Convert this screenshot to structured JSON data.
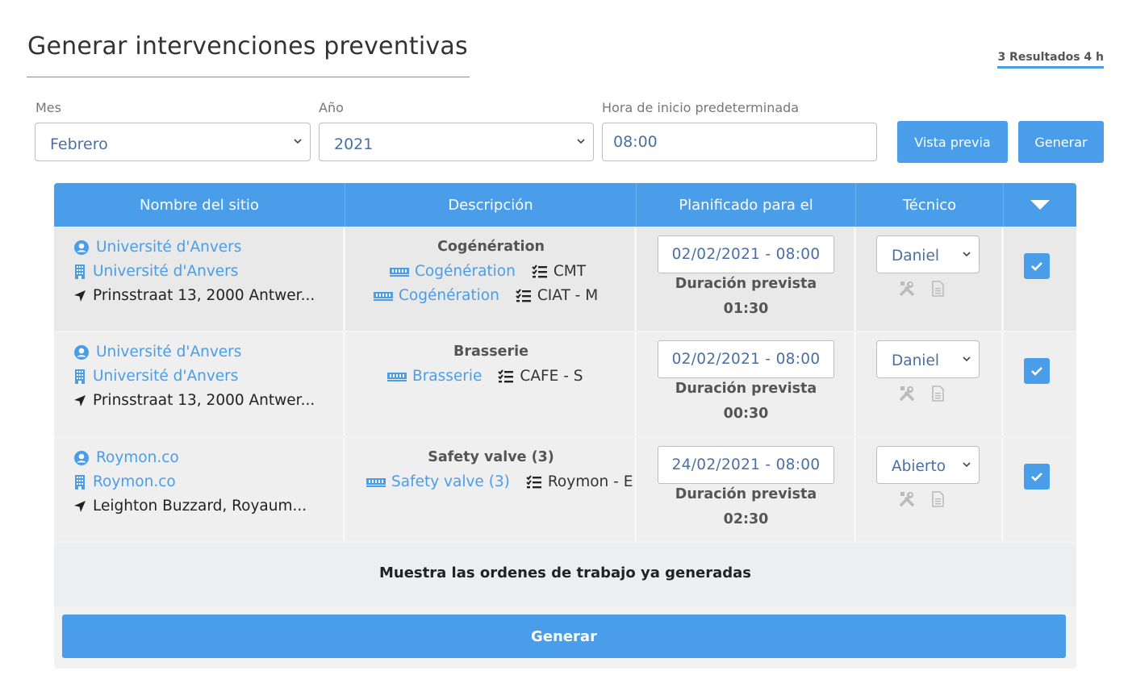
{
  "page": {
    "title": "Generar intervenciones preventivas",
    "results_badge": "3 Resultados 4 h"
  },
  "filters": {
    "month_label": "Mes",
    "month_value": "Febrero",
    "year_label": "Año",
    "year_value": "2021",
    "start_time_label": "Hora de inicio predeterminada",
    "start_time_value": "08:00",
    "preview_button": "Vista previa",
    "generate_button": "Generar"
  },
  "table": {
    "headers": [
      "Nombre del sitio",
      "Descripción",
      "Planificado para el",
      "Técnico"
    ],
    "rows": [
      {
        "client": "Université d'Anvers",
        "site": "Université d'Anvers",
        "address": "Prinsstraat 13, 2000 Antwer...",
        "desc_title": "Cogénération",
        "equipment": [
          {
            "name": "Cogénération",
            "checklist": "CMT"
          },
          {
            "name": "Cogénération",
            "checklist": "CIAT - M"
          }
        ],
        "planned": "02/02/2021 - 08:00",
        "duration_label": "Duración prevista",
        "duration": "01:30",
        "technician": "Daniel",
        "checked": true
      },
      {
        "client": "Université d'Anvers",
        "site": "Université d'Anvers",
        "address": "Prinsstraat 13, 2000 Antwer...",
        "desc_title": "Brasserie",
        "equipment": [
          {
            "name": "Brasserie",
            "checklist": "CAFE - S"
          }
        ],
        "planned": "02/02/2021 - 08:00",
        "duration_label": "Duración prevista",
        "duration": "00:30",
        "technician": "Daniel",
        "checked": true
      },
      {
        "client": "Roymon.co",
        "site": "Roymon.co",
        "address": "Leighton Buzzard, Royaum...",
        "desc_title": "Safety valve (3)",
        "equipment": [
          {
            "name": "Safety valve (3)",
            "checklist": "Roymon - E"
          }
        ],
        "planned": "24/02/2021 - 08:00",
        "duration_label": "Duración prevista",
        "duration": "02:30",
        "technician": "Abierto",
        "checked": true
      }
    ],
    "footer_link": "Muestra las ordenes de trabajo ya generadas",
    "generate_bottom": "Generar"
  },
  "colors": {
    "accent": "#4a9de8",
    "row_bg": "#efefef",
    "text_link": "#4a9de8"
  }
}
